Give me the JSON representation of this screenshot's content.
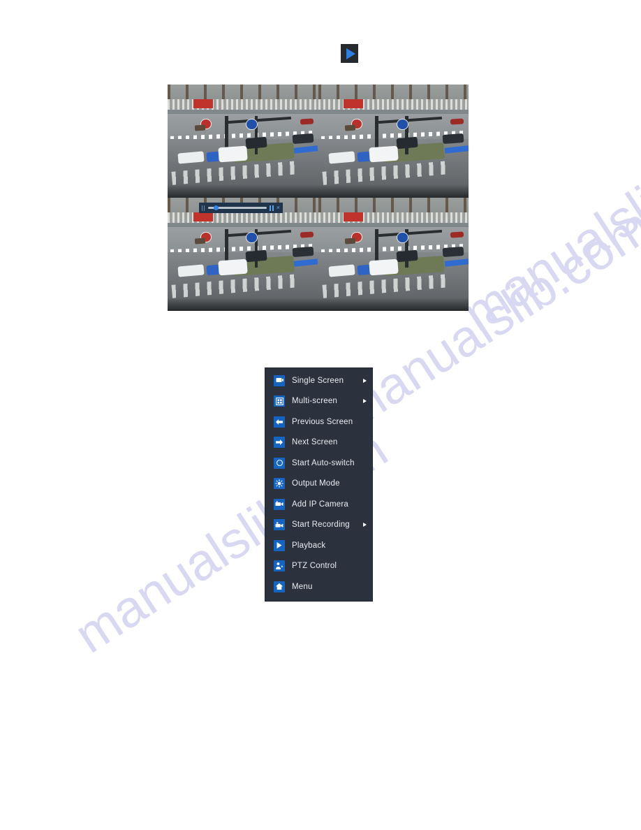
{
  "page": {
    "background": "#ffffff",
    "watermark_text": "manualslib.com",
    "watermark_color": "#d8d8f2"
  },
  "top_control": {
    "icon": "play-icon",
    "label": "Play",
    "badge_bg": "#26292e",
    "triangle_color": "#2f7fe0"
  },
  "video_wall": {
    "layout": "2x2",
    "selected_pane_index": 0,
    "selection_color": "#e2e830",
    "panes": [
      {
        "name": "camera-pane-1",
        "scene": "street intersection with cars"
      },
      {
        "name": "camera-pane-2",
        "scene": "street intersection with cars"
      },
      {
        "name": "camera-pane-3",
        "scene": "street intersection with cars"
      },
      {
        "name": "camera-pane-4",
        "scene": "street intersection with cars"
      }
    ]
  },
  "playback_bar": {
    "background": "#20354b",
    "accent": "#2f86e8",
    "progress_percent": 14,
    "pause_icon": "pause-icon",
    "close_icon": "close-icon",
    "close_glyph": "×"
  },
  "context_menu": {
    "background": "#2b323d",
    "icon_color": "#1565c0",
    "text_color": "#e9edf2",
    "items": [
      {
        "label": "Single Screen",
        "icon": "monitor-icon",
        "has_submenu": true
      },
      {
        "label": "Multi-screen",
        "icon": "grid-icon",
        "has_submenu": true
      },
      {
        "label": "Previous Screen",
        "icon": "arrow-left-icon",
        "has_submenu": false
      },
      {
        "label": "Next Screen",
        "icon": "arrow-right-icon",
        "has_submenu": false
      },
      {
        "label": "Start Auto-switch",
        "icon": "circle-icon",
        "has_submenu": false
      },
      {
        "label": "Output Mode",
        "icon": "brightness-icon",
        "has_submenu": false
      },
      {
        "label": "Add IP Camera",
        "icon": "camera-icon",
        "has_submenu": false
      },
      {
        "label": "Start Recording",
        "icon": "record-icon",
        "has_submenu": true
      },
      {
        "label": "Playback",
        "icon": "play-icon",
        "has_submenu": false
      },
      {
        "label": "PTZ Control",
        "icon": "ptz-icon",
        "has_submenu": false
      },
      {
        "label": "Menu",
        "icon": "home-icon",
        "has_submenu": false
      }
    ]
  }
}
